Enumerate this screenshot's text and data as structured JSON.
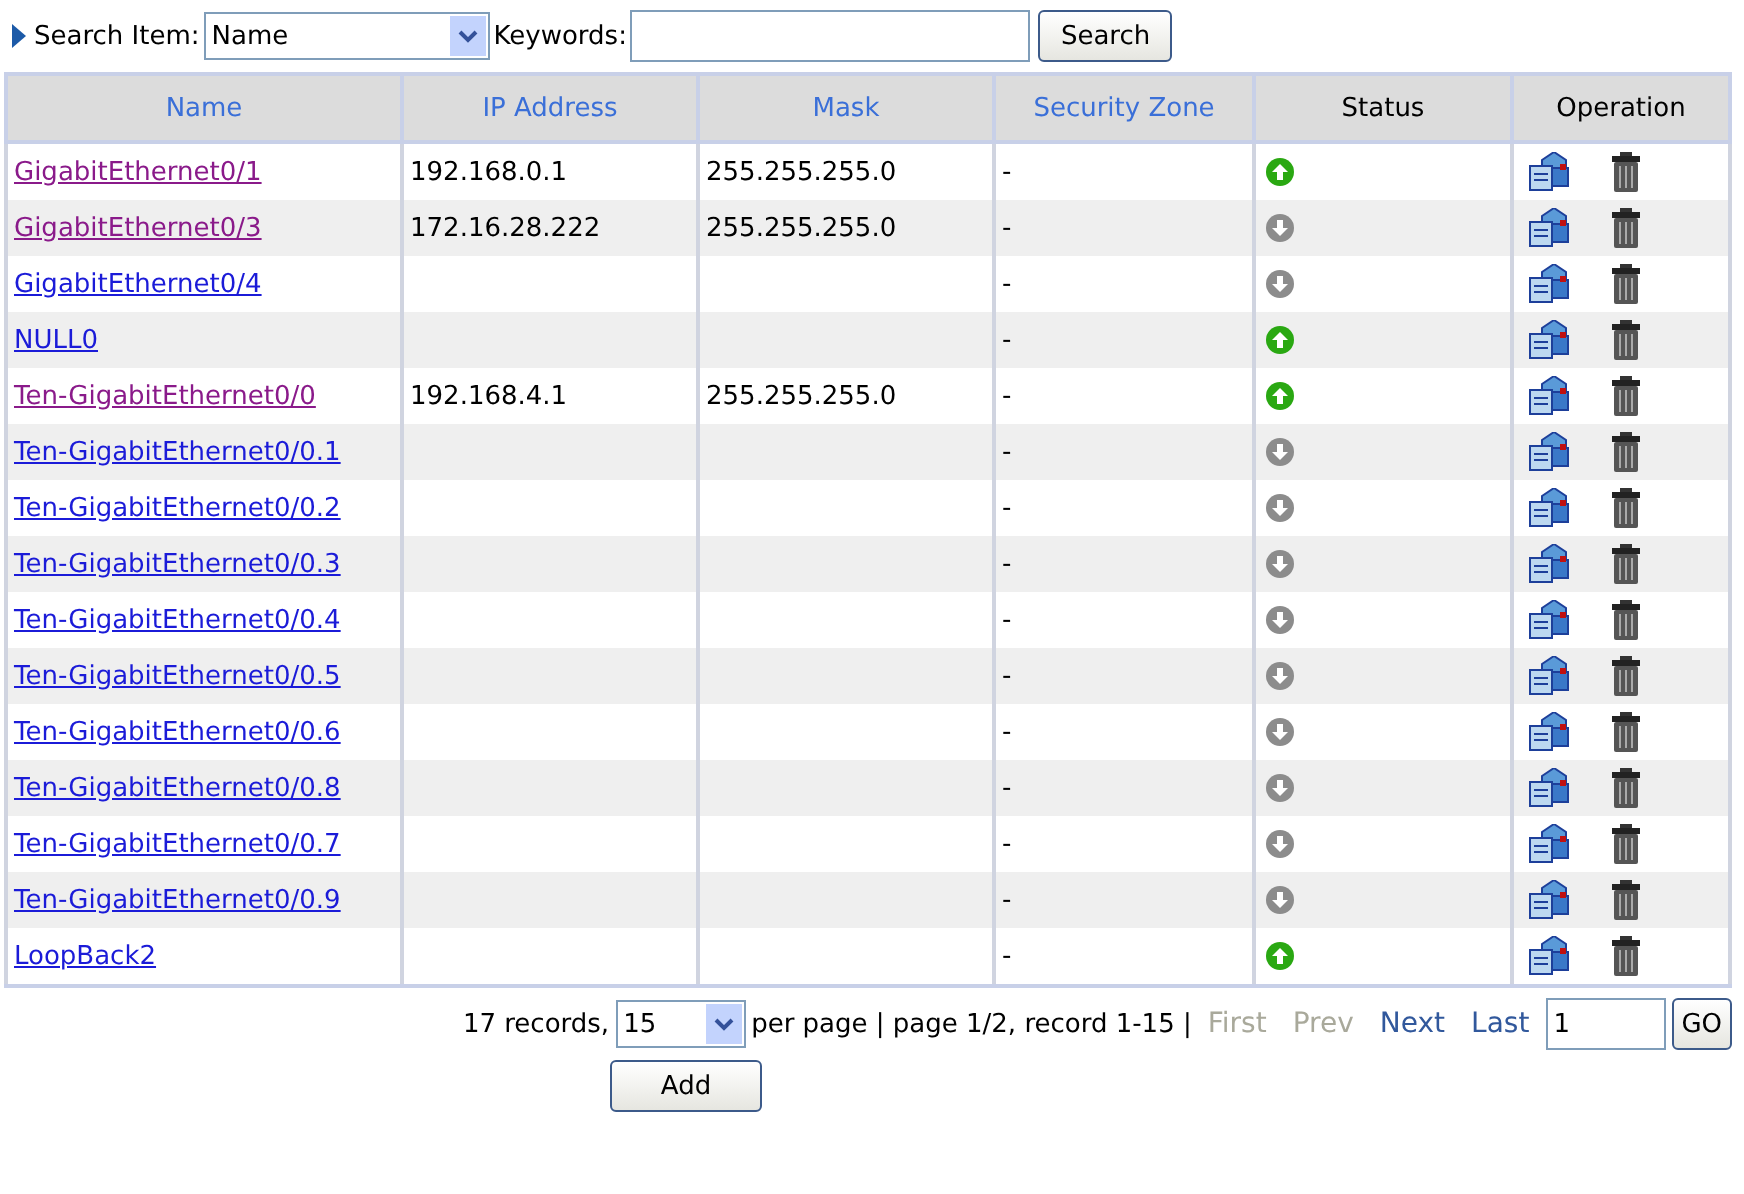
{
  "search": {
    "item_label": "Search Item:",
    "item_value": "Name",
    "keywords_label": "Keywords:",
    "button": "Search"
  },
  "table": {
    "columns": [
      "Name",
      "IP Address",
      "Mask",
      "Security Zone",
      "Status",
      "Operation"
    ],
    "rows": [
      {
        "name": "GigabitEthernet0/1",
        "visited": true,
        "ip": "192.168.0.1",
        "mask": "255.255.255.0",
        "zone": "-",
        "up": true
      },
      {
        "name": "GigabitEthernet0/3",
        "visited": true,
        "ip": "172.16.28.222",
        "mask": "255.255.255.0",
        "zone": "-",
        "up": false
      },
      {
        "name": "GigabitEthernet0/4",
        "visited": false,
        "zone": "-",
        "up": false
      },
      {
        "name": "NULL0",
        "visited": false,
        "zone": "-",
        "up": true
      },
      {
        "name": "Ten-GigabitEthernet0/0",
        "visited": true,
        "ip": "192.168.4.1",
        "mask": "255.255.255.0",
        "zone": "-",
        "up": true
      },
      {
        "name": "Ten-GigabitEthernet0/0.1",
        "visited": false,
        "zone": "-",
        "up": false
      },
      {
        "name": "Ten-GigabitEthernet0/0.2",
        "visited": false,
        "zone": "-",
        "up": false
      },
      {
        "name": "Ten-GigabitEthernet0/0.3",
        "visited": false,
        "zone": "-",
        "up": false
      },
      {
        "name": "Ten-GigabitEthernet0/0.4",
        "visited": false,
        "zone": "-",
        "up": false
      },
      {
        "name": "Ten-GigabitEthernet0/0.5",
        "visited": false,
        "zone": "-",
        "up": false
      },
      {
        "name": "Ten-GigabitEthernet0/0.6",
        "visited": false,
        "zone": "-",
        "up": false
      },
      {
        "name": "Ten-GigabitEthernet0/0.8",
        "visited": false,
        "zone": "-",
        "up": false
      },
      {
        "name": "Ten-GigabitEthernet0/0.7",
        "visited": false,
        "zone": "-",
        "up": false
      },
      {
        "name": "Ten-GigabitEthernet0/0.9",
        "visited": false,
        "zone": "-",
        "up": false
      },
      {
        "name": "LoopBack2",
        "visited": false,
        "zone": "-",
        "up": true
      }
    ]
  },
  "pager": {
    "records": "17 records,",
    "per_page_value": "15",
    "summary": "per page | page 1/2, record 1-15 |",
    "links": [
      {
        "label": "First",
        "disabled": true
      },
      {
        "label": "Prev",
        "disabled": true
      },
      {
        "label": "Next",
        "disabled": false
      },
      {
        "label": "Last",
        "disabled": false
      }
    ],
    "page_value": "1",
    "go": "GO"
  },
  "add_button": "Add"
}
